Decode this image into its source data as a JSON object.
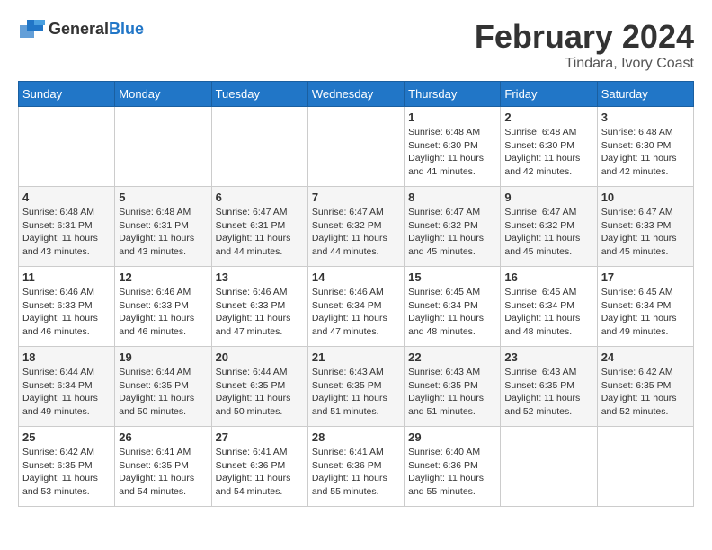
{
  "header": {
    "logo_general": "General",
    "logo_blue": "Blue",
    "month_year": "February 2024",
    "location": "Tindara, Ivory Coast"
  },
  "days_of_week": [
    "Sunday",
    "Monday",
    "Tuesday",
    "Wednesday",
    "Thursday",
    "Friday",
    "Saturday"
  ],
  "weeks": [
    [
      {
        "day": "",
        "sunrise": "",
        "sunset": "",
        "daylight": ""
      },
      {
        "day": "",
        "sunrise": "",
        "sunset": "",
        "daylight": ""
      },
      {
        "day": "",
        "sunrise": "",
        "sunset": "",
        "daylight": ""
      },
      {
        "day": "",
        "sunrise": "",
        "sunset": "",
        "daylight": ""
      },
      {
        "day": "1",
        "sunrise": "Sunrise: 6:48 AM",
        "sunset": "Sunset: 6:30 PM",
        "daylight": "Daylight: 11 hours and 41 minutes."
      },
      {
        "day": "2",
        "sunrise": "Sunrise: 6:48 AM",
        "sunset": "Sunset: 6:30 PM",
        "daylight": "Daylight: 11 hours and 42 minutes."
      },
      {
        "day": "3",
        "sunrise": "Sunrise: 6:48 AM",
        "sunset": "Sunset: 6:30 PM",
        "daylight": "Daylight: 11 hours and 42 minutes."
      }
    ],
    [
      {
        "day": "4",
        "sunrise": "Sunrise: 6:48 AM",
        "sunset": "Sunset: 6:31 PM",
        "daylight": "Daylight: 11 hours and 43 minutes."
      },
      {
        "day": "5",
        "sunrise": "Sunrise: 6:48 AM",
        "sunset": "Sunset: 6:31 PM",
        "daylight": "Daylight: 11 hours and 43 minutes."
      },
      {
        "day": "6",
        "sunrise": "Sunrise: 6:47 AM",
        "sunset": "Sunset: 6:31 PM",
        "daylight": "Daylight: 11 hours and 44 minutes."
      },
      {
        "day": "7",
        "sunrise": "Sunrise: 6:47 AM",
        "sunset": "Sunset: 6:32 PM",
        "daylight": "Daylight: 11 hours and 44 minutes."
      },
      {
        "day": "8",
        "sunrise": "Sunrise: 6:47 AM",
        "sunset": "Sunset: 6:32 PM",
        "daylight": "Daylight: 11 hours and 45 minutes."
      },
      {
        "day": "9",
        "sunrise": "Sunrise: 6:47 AM",
        "sunset": "Sunset: 6:32 PM",
        "daylight": "Daylight: 11 hours and 45 minutes."
      },
      {
        "day": "10",
        "sunrise": "Sunrise: 6:47 AM",
        "sunset": "Sunset: 6:33 PM",
        "daylight": "Daylight: 11 hours and 45 minutes."
      }
    ],
    [
      {
        "day": "11",
        "sunrise": "Sunrise: 6:46 AM",
        "sunset": "Sunset: 6:33 PM",
        "daylight": "Daylight: 11 hours and 46 minutes."
      },
      {
        "day": "12",
        "sunrise": "Sunrise: 6:46 AM",
        "sunset": "Sunset: 6:33 PM",
        "daylight": "Daylight: 11 hours and 46 minutes."
      },
      {
        "day": "13",
        "sunrise": "Sunrise: 6:46 AM",
        "sunset": "Sunset: 6:33 PM",
        "daylight": "Daylight: 11 hours and 47 minutes."
      },
      {
        "day": "14",
        "sunrise": "Sunrise: 6:46 AM",
        "sunset": "Sunset: 6:34 PM",
        "daylight": "Daylight: 11 hours and 47 minutes."
      },
      {
        "day": "15",
        "sunrise": "Sunrise: 6:45 AM",
        "sunset": "Sunset: 6:34 PM",
        "daylight": "Daylight: 11 hours and 48 minutes."
      },
      {
        "day": "16",
        "sunrise": "Sunrise: 6:45 AM",
        "sunset": "Sunset: 6:34 PM",
        "daylight": "Daylight: 11 hours and 48 minutes."
      },
      {
        "day": "17",
        "sunrise": "Sunrise: 6:45 AM",
        "sunset": "Sunset: 6:34 PM",
        "daylight": "Daylight: 11 hours and 49 minutes."
      }
    ],
    [
      {
        "day": "18",
        "sunrise": "Sunrise: 6:44 AM",
        "sunset": "Sunset: 6:34 PM",
        "daylight": "Daylight: 11 hours and 49 minutes."
      },
      {
        "day": "19",
        "sunrise": "Sunrise: 6:44 AM",
        "sunset": "Sunset: 6:35 PM",
        "daylight": "Daylight: 11 hours and 50 minutes."
      },
      {
        "day": "20",
        "sunrise": "Sunrise: 6:44 AM",
        "sunset": "Sunset: 6:35 PM",
        "daylight": "Daylight: 11 hours and 50 minutes."
      },
      {
        "day": "21",
        "sunrise": "Sunrise: 6:43 AM",
        "sunset": "Sunset: 6:35 PM",
        "daylight": "Daylight: 11 hours and 51 minutes."
      },
      {
        "day": "22",
        "sunrise": "Sunrise: 6:43 AM",
        "sunset": "Sunset: 6:35 PM",
        "daylight": "Daylight: 11 hours and 51 minutes."
      },
      {
        "day": "23",
        "sunrise": "Sunrise: 6:43 AM",
        "sunset": "Sunset: 6:35 PM",
        "daylight": "Daylight: 11 hours and 52 minutes."
      },
      {
        "day": "24",
        "sunrise": "Sunrise: 6:42 AM",
        "sunset": "Sunset: 6:35 PM",
        "daylight": "Daylight: 11 hours and 52 minutes."
      }
    ],
    [
      {
        "day": "25",
        "sunrise": "Sunrise: 6:42 AM",
        "sunset": "Sunset: 6:35 PM",
        "daylight": "Daylight: 11 hours and 53 minutes."
      },
      {
        "day": "26",
        "sunrise": "Sunrise: 6:41 AM",
        "sunset": "Sunset: 6:35 PM",
        "daylight": "Daylight: 11 hours and 54 minutes."
      },
      {
        "day": "27",
        "sunrise": "Sunrise: 6:41 AM",
        "sunset": "Sunset: 6:36 PM",
        "daylight": "Daylight: 11 hours and 54 minutes."
      },
      {
        "day": "28",
        "sunrise": "Sunrise: 6:41 AM",
        "sunset": "Sunset: 6:36 PM",
        "daylight": "Daylight: 11 hours and 55 minutes."
      },
      {
        "day": "29",
        "sunrise": "Sunrise: 6:40 AM",
        "sunset": "Sunset: 6:36 PM",
        "daylight": "Daylight: 11 hours and 55 minutes."
      },
      {
        "day": "",
        "sunrise": "",
        "sunset": "",
        "daylight": ""
      },
      {
        "day": "",
        "sunrise": "",
        "sunset": "",
        "daylight": ""
      }
    ]
  ]
}
